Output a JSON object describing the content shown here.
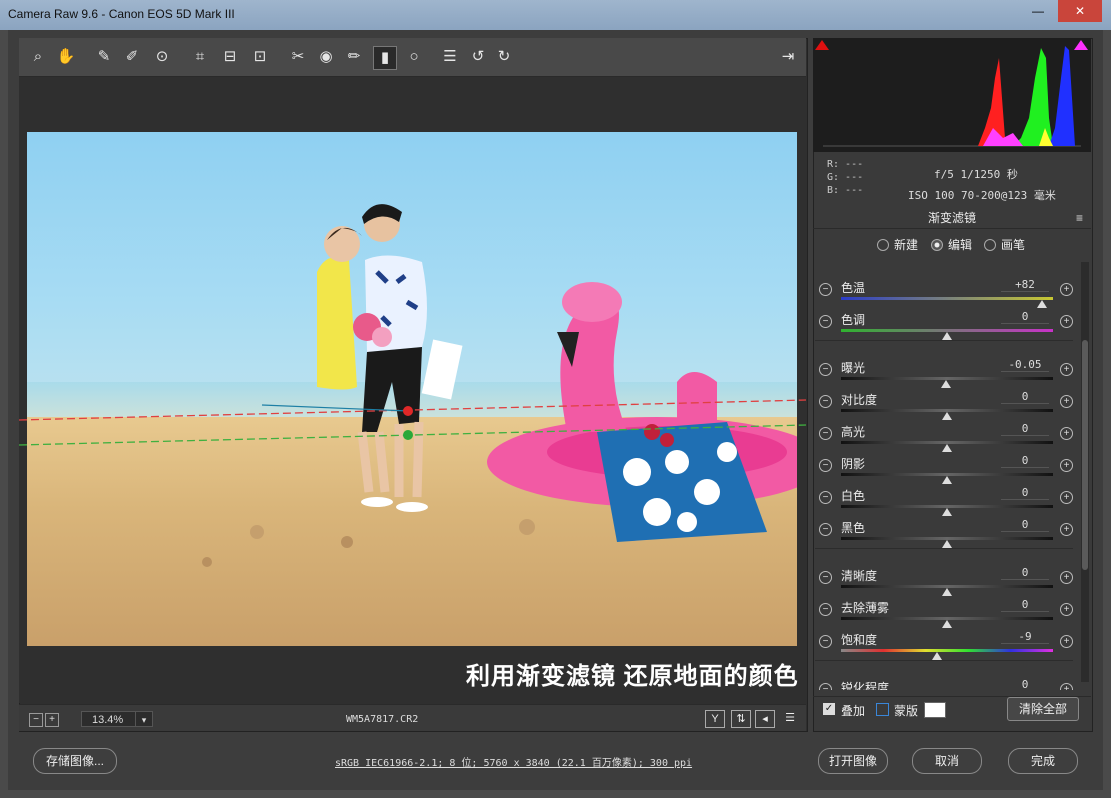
{
  "window": {
    "title": "Camera Raw 9.6 -  Canon EOS 5D Mark III",
    "minimize": "—",
    "close": "✕"
  },
  "toolbar": {
    "tools": [
      "zoom-icon",
      "hand-icon",
      "white-balance-icon",
      "color-sampler-icon",
      "targeted-adjust-icon",
      "crop-icon",
      "straighten-icon",
      "transform-icon",
      "spot-removal-icon",
      "red-eye-icon",
      "adjustment-brush-icon",
      "graduated-filter-icon",
      "radial-filter-icon",
      "presets-icon",
      "rotate-ccw-icon",
      "rotate-cw-icon"
    ],
    "fullscreen_icon": "fullscreen-icon"
  },
  "image": {
    "caption": "利用渐变滤镜 还原地面的颜色"
  },
  "statusbar": {
    "zoom": "13.4%",
    "filename": "WM5A7817.CR2",
    "zoom_minus": "−",
    "zoom_plus": "+"
  },
  "histogram": {
    "rgb": [
      "R:  ---",
      "G:  ---",
      "B:  ---"
    ],
    "camera_line1": "f/5  1/1250 秒",
    "camera_line2": "ISO 100  70-200@123 毫米"
  },
  "panel": {
    "title": "渐变滤镜",
    "modes": [
      {
        "label": "新建",
        "selected": false
      },
      {
        "label": "编辑",
        "selected": true
      },
      {
        "label": "画笔",
        "selected": false
      }
    ],
    "sliders": [
      {
        "label": "色温",
        "value": "+82",
        "position": 0.95,
        "track": "temp"
      },
      {
        "label": "色调",
        "value": "0",
        "position": 0.5,
        "track": "tint"
      },
      {
        "label": "曝光",
        "value": "-0.05",
        "position": 0.495,
        "track": "gray"
      },
      {
        "label": "对比度",
        "value": "0",
        "position": 0.5,
        "track": "gray"
      },
      {
        "label": "高光",
        "value": "0",
        "position": 0.5,
        "track": "gray"
      },
      {
        "label": "阴影",
        "value": "0",
        "position": 0.5,
        "track": "gray"
      },
      {
        "label": "白色",
        "value": "0",
        "position": 0.5,
        "track": "gray"
      },
      {
        "label": "黑色",
        "value": "0",
        "position": 0.5,
        "track": "gray"
      },
      {
        "label": "清晰度",
        "value": "0",
        "position": 0.5,
        "track": "gray"
      },
      {
        "label": "去除薄雾",
        "value": "0",
        "position": 0.5,
        "track": "gray"
      },
      {
        "label": "饱和度",
        "value": "-9",
        "position": 0.455,
        "track": "sat"
      },
      {
        "label": "锐化程度",
        "value": "0",
        "position": 0.5,
        "track": "gray"
      }
    ],
    "overlay_label": "叠加",
    "mask_label": "蒙版",
    "clear_all": "清除全部"
  },
  "footer": {
    "save": "存储图像...",
    "info": "sRGB IEC61966-2.1; 8 位; 5760 x 3840 (22.1 百万像素); 300 ppi",
    "open": "打开图像",
    "cancel": "取消",
    "done": "完成"
  }
}
